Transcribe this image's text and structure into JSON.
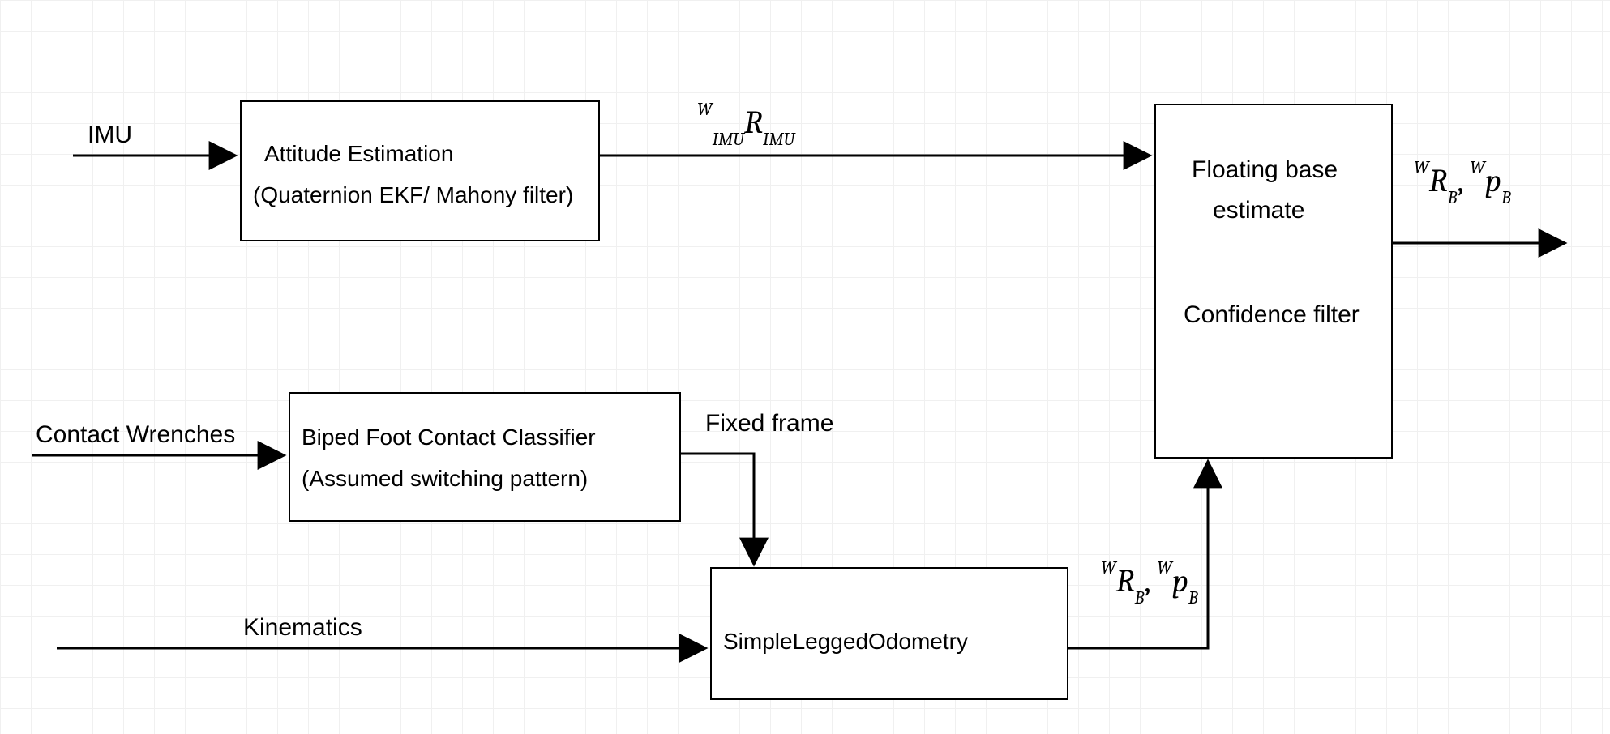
{
  "inputs": {
    "imu": "IMU",
    "contact_wrenches": "Contact Wrenches",
    "kinematics": "Kinematics"
  },
  "blocks": {
    "attitude": {
      "line1": "Attitude Estimation",
      "line2": "(Quaternion EKF/ Mahony filter)"
    },
    "contact_classifier": {
      "line1": "Biped Foot Contact Classifier",
      "line2": "(Assumed switching pattern)"
    },
    "odometry": {
      "line1": "SimpleLeggedOdometry"
    },
    "floating_base": {
      "line1": "Floating base",
      "line2": "estimate",
      "line3": "Confidence filter"
    }
  },
  "edge_labels": {
    "fixed_frame": "Fixed frame"
  },
  "math": {
    "wimu_r_imu": {
      "presup": "W",
      "presub": "IMU",
      "var": "R",
      "sub": "IMU"
    },
    "wrb_wpb_mid": {
      "term1": {
        "presup": "W",
        "var": "R",
        "sub": "B"
      },
      "sep": ", ",
      "term2": {
        "presup": "W",
        "var": "p",
        "sub": "B"
      }
    },
    "wrb_wpb_out": {
      "term1": {
        "presup": "W",
        "var": "R",
        "sub": "B"
      },
      "sep": ", ",
      "term2": {
        "presup": "W",
        "var": "p",
        "sub": "B"
      }
    }
  }
}
